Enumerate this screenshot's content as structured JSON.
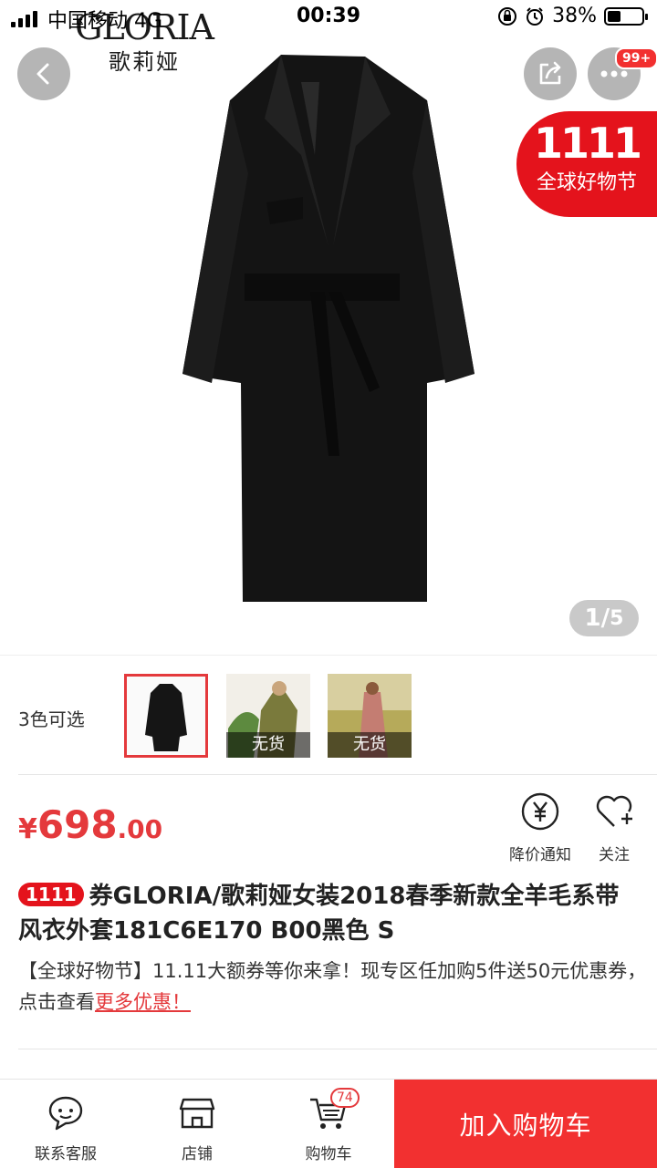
{
  "status_bar": {
    "carrier": "中国移动  4G",
    "time": "00:39",
    "battery": "38%",
    "battery_level": 0.38
  },
  "brand": {
    "name_en": "GLORIA",
    "name_cn": "歌莉娅"
  },
  "header": {
    "menu_badge": "99+"
  },
  "promo": {
    "logo": "1111",
    "text": "全球好物节"
  },
  "gallery": {
    "counter_current": "1",
    "counter_total": "5"
  },
  "colors": {
    "label": "3色可选",
    "options": [
      {
        "status": "",
        "selected": true
      },
      {
        "status": "无货",
        "selected": false
      },
      {
        "status": "无货",
        "selected": false
      }
    ]
  },
  "price": {
    "symbol": "¥",
    "integer": "698",
    "decimal": ".00"
  },
  "actions": {
    "notify_label": "降价通知",
    "follow_label": "关注"
  },
  "product": {
    "tag": "1111",
    "title": "券GLORIA/歌莉娅女装2018春季新款全羊毛系带风衣外套181C6E170 B00黑色 S",
    "promo_text": "【全球好物节】11.11大额券等你来拿！现专区任加购5件送50元优惠券，点击查看",
    "promo_link": "更多优惠！"
  },
  "bottom_bar": {
    "service_label": "联系客服",
    "shop_label": "店铺",
    "cart_label": "购物车",
    "cart_count": "74",
    "add_to_cart_label": "加入购物车"
  },
  "colors_theme": {
    "accent": "#e4393c",
    "promo_red": "#e4131c",
    "add_cart_red": "#f23030"
  }
}
